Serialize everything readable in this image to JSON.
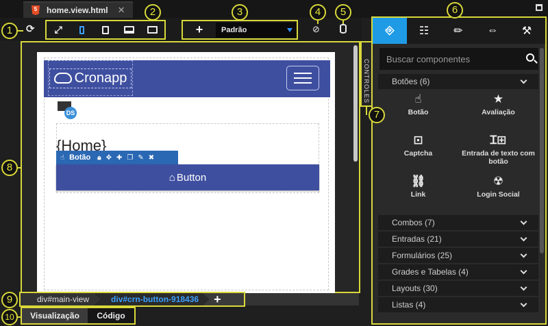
{
  "file_tab": {
    "name": "home.view.html",
    "close": "✕"
  },
  "toolbar": {
    "mode_select": "Padrão",
    "plus": "+"
  },
  "callouts": [
    "1",
    "2",
    "3",
    "4",
    "5",
    "6",
    "7",
    "8",
    "9",
    "10"
  ],
  "canvas": {
    "logo_text": "Cronapp",
    "ds_badge": "DS",
    "home_title": "{Home}",
    "component_bar_label": "Botão",
    "button_text": "Button"
  },
  "controls_label": "CONTROLES",
  "breadcrumb": {
    "items": [
      "div#main-view",
      "div#crn-button-918436"
    ],
    "add": "+"
  },
  "view_tabs": [
    "Visualização",
    "Código"
  ],
  "panel": {
    "search_placeholder": "Buscar componentes",
    "categories": [
      "Botões (6)",
      "Combos (7)",
      "Entradas (21)",
      "Formulários (25)",
      "Grades e Tabelas (4)",
      "Layouts (30)",
      "Listas (4)"
    ],
    "components": [
      {
        "label": "Botão",
        "icon": "hand-pointer-icon"
      },
      {
        "label": "Avaliação",
        "icon": "star-icon"
      },
      {
        "label": "Captcha",
        "icon": "captcha-icon"
      },
      {
        "label": "Entrada de texto com botão",
        "icon": "text-input-button-icon"
      },
      {
        "label": "Link",
        "icon": "link-icon"
      },
      {
        "label": "Login Social",
        "icon": "social-login-icon"
      }
    ]
  },
  "colors": {
    "accent": "#1f9be6",
    "navbar": "#3f4fa0",
    "callout": "#d9d93a",
    "breadcrumb_active": "#3aa0ff"
  }
}
